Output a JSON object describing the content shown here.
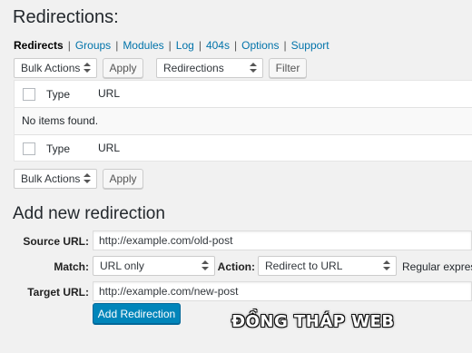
{
  "page": {
    "title": "Redirections:",
    "subnav": [
      {
        "label": "Redirects",
        "current": true
      },
      {
        "label": "Groups",
        "current": false
      },
      {
        "label": "Modules",
        "current": false
      },
      {
        "label": "Log",
        "current": false
      },
      {
        "label": "404s",
        "current": false
      },
      {
        "label": "Options",
        "current": false
      },
      {
        "label": "Support",
        "current": false
      }
    ],
    "separator": "|"
  },
  "toolbar_top": {
    "bulk_actions": "Bulk Actions",
    "apply": "Apply",
    "filter_select": "Redirections",
    "filter": "Filter"
  },
  "table": {
    "col_type": "Type",
    "col_url": "URL",
    "empty_message": "No items found."
  },
  "toolbar_bottom": {
    "bulk_actions": "Bulk Actions",
    "apply": "Apply"
  },
  "add_form": {
    "heading": "Add new redirection",
    "source_label": "Source URL:",
    "source_value": "http://example.com/old-post",
    "match_label": "Match:",
    "match_value": "URL only",
    "action_label": "Action:",
    "action_value": "Redirect to URL",
    "regex_label": "Regular express",
    "target_label": "Target URL:",
    "target_value": "http://example.com/new-post",
    "submit": "Add Redirection"
  },
  "watermark": "ĐỒNG THÁP WEB"
}
